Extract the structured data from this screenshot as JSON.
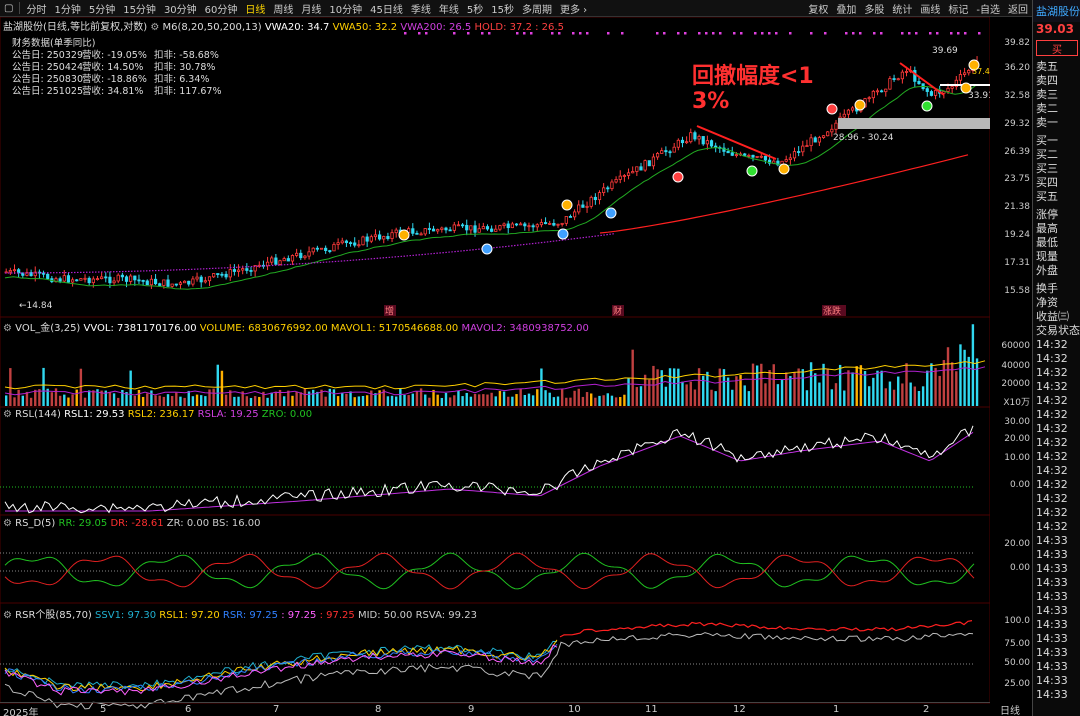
{
  "toolbar": {
    "periods": [
      "分时",
      "1分钟",
      "5分钟",
      "15分钟",
      "30分钟",
      "60分钟",
      "日线",
      "周线",
      "月线",
      "10分钟",
      "45日线",
      "季线",
      "年线",
      "5秒",
      "15秒",
      "多周期",
      "更多 ›"
    ],
    "active_index": 6,
    "actions": [
      "复权",
      "叠加",
      "多股",
      "统计",
      "画线",
      "标记",
      "-自选",
      "返回"
    ]
  },
  "main_header": {
    "title": "盐湖股份(日线,等比前复权,对数)",
    "m6": "M6(8,20,50,200,13)",
    "vwa20": "VWA20: 34.7",
    "vwa50": "VWA50: 32.2",
    "vwa200": "VWA200: 26.5",
    "hold": "HOLD: 37.2 : 26.5"
  },
  "finance": {
    "title": "财务数据(单季同比)",
    "rows": [
      {
        "date": "公告日: 250329",
        "rev": "营收: -19.05%",
        "np": "扣非: -58.68%"
      },
      {
        "date": "公告日: 250424",
        "rev": "营收: 14.50%",
        "np": "扣非: 30.78%"
      },
      {
        "date": "公告日: 250830",
        "rev": "营收: -18.86%",
        "np": "扣非: 6.34%"
      },
      {
        "date": "公告日: 251025",
        "rev": "营收: 34.81%",
        "np": "扣非: 117.67%"
      }
    ]
  },
  "annotation": {
    "line1": "回撤幅度<1",
    "line2": "3%"
  },
  "price_labels": {
    "high": "39.69",
    "low": "14.84",
    "hold_a": "37.4",
    "hold_b": "33.91",
    "range": "28.96 - 30.24",
    "markers": [
      "增",
      "财",
      "涨跌"
    ]
  },
  "price_axis": [
    "39.82",
    "36.20",
    "32.58",
    "29.32",
    "26.39",
    "23.75",
    "21.38",
    "19.24",
    "17.31",
    "15.58"
  ],
  "volume": {
    "header": "VOL_金(3,25)",
    "vvol": "VVOL: 7381170176.00",
    "volume": "VOLUME: 6830676992.00",
    "mavol1": "MAVOL1: 5170546688.00",
    "mavol2": "MAVOL2: 3480938752.00",
    "axis": [
      "60000",
      "40000",
      "20000"
    ],
    "unit": "X10万"
  },
  "rsl": {
    "header": "RSL(144)",
    "rsl1": "RSL1: 29.53",
    "rsl2": "RSL2: 236.17",
    "rsla": "RSLA: 19.25",
    "zro": "ZRO: 0.00",
    "axis": [
      "30.00",
      "20.00",
      "10.00",
      "0.00"
    ]
  },
  "rsd": {
    "header": "RS_D(5)",
    "rr": "RR: 29.05",
    "dr": "DR: -28.61",
    "zr": "ZR: 0.00",
    "bs": "BS: 16.00",
    "axis": [
      "20.00",
      "0.00"
    ]
  },
  "rsr": {
    "header": "RSR个股(85,70)",
    "ssv1": "SSV1: 97.30",
    "rsl1": "RSL1: 97.20",
    "rsr": "RSR: 97.25",
    "v1": ": 97.25",
    "v2": ": 97.25",
    "mid": "MID: 50.00",
    "rsva": "RSVA: 99.23",
    "axis": [
      "100.0",
      "75.00",
      "50.00",
      "25.00"
    ]
  },
  "time_axis": [
    "2025年",
    "5",
    "6",
    "7",
    "8",
    "9",
    "10",
    "11",
    "12",
    "1",
    "2"
  ],
  "time_axis_right": "日线",
  "quote": {
    "name": "盐湖股份",
    "price": "39.03",
    "buy_label": "买",
    "sells": [
      "卖五",
      "卖四",
      "卖三",
      "卖二",
      "卖一"
    ],
    "buys": [
      "买一",
      "买二",
      "买三",
      "买四",
      "买五"
    ],
    "stats": [
      "涨停",
      "最高",
      "最低",
      "现量",
      "外盘"
    ],
    "more": [
      "换手",
      "净资",
      "收益㈢"
    ],
    "trade_title": "交易状态",
    "times": [
      "14:32",
      "14:32",
      "14:32",
      "14:32",
      "14:32",
      "14:32",
      "14:32",
      "14:32",
      "14:32",
      "14:32",
      "14:32",
      "14:32",
      "14:32",
      "14:32",
      "14:33",
      "14:33",
      "14:33",
      "14:33",
      "14:33",
      "14:33",
      "14:33",
      "14:33",
      "14:33",
      "14:33",
      "14:33",
      "14:33"
    ]
  },
  "colors": {
    "up": "#ff3b3b",
    "down": "#30d8f0",
    "ma": "#22aa22",
    "purple": "#b020d0",
    "yellow": "#ffd000",
    "magenta": "#ff40ff",
    "white": "#ffffff"
  }
}
